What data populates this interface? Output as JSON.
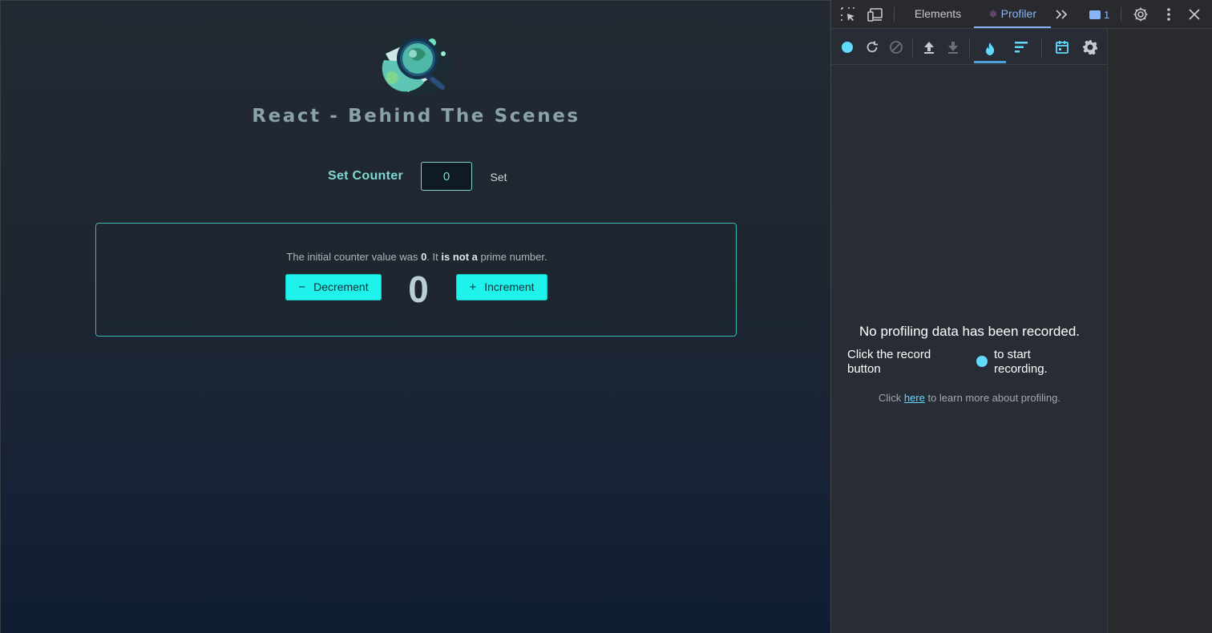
{
  "app": {
    "title": "React - Behind The Scenes",
    "set_counter": {
      "label": "Set Counter",
      "input_value": "0",
      "button_label": "Set"
    },
    "counter": {
      "info_prefix": "The initial counter value was ",
      "info_value": "0",
      "info_mid": ". It ",
      "info_status": "is not a",
      "info_suffix": " prime number.",
      "decrement_label": "Decrement",
      "increment_label": "Increment",
      "value": "0"
    }
  },
  "devtools": {
    "tabs": [
      {
        "label": "Elements"
      },
      {
        "label": "Profiler",
        "active": true
      }
    ],
    "message_count": "1",
    "icons": {
      "inspect": "inspect-element-icon",
      "device": "device-toolbar-icon",
      "more_tabs": "chevron-double-right-icon",
      "messages": "message-icon",
      "settings": "gear-icon",
      "menu": "kebab-menu-icon",
      "close": "close-icon"
    },
    "profiler": {
      "toolbar_icons": [
        "record-icon",
        "reload-icon",
        "clear-icon",
        "upload-icon",
        "download-icon",
        "flame-chart-icon",
        "ranked-chart-icon",
        "timeline-icon",
        "settings-icon"
      ],
      "empty_title": "No profiling data has been recorded.",
      "empty_left": "Click the record button",
      "empty_right": "to start recording.",
      "learn_prefix": "Click ",
      "learn_link": "here",
      "learn_suffix": " to learn more about profiling."
    }
  },
  "colors": {
    "accent_cyan": "#1ff2ea",
    "devtools_active": "#8ab4f8",
    "react_blue": "#61dafb"
  }
}
